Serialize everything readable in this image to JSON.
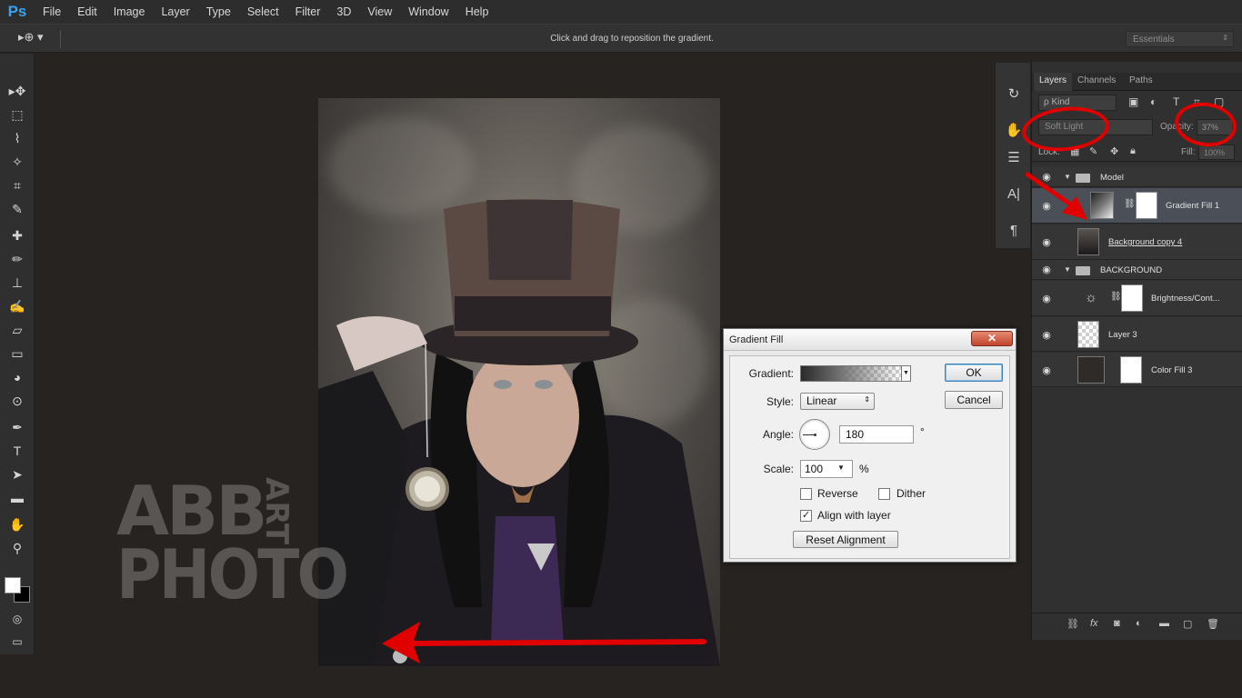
{
  "app": {
    "logo": "Ps"
  },
  "menu": [
    "File",
    "Edit",
    "Image",
    "Layer",
    "Type",
    "Select",
    "Filter",
    "3D",
    "View",
    "Window",
    "Help"
  ],
  "options_bar": {
    "tool_preset": "▸⊕ ▾",
    "hint": "Click and drag to reposition the gradient.",
    "workspace": "Essentials"
  },
  "tools": {
    "icons": [
      "move-tool-icon",
      "marquee-tool-icon",
      "lasso-tool-icon",
      "magic-wand-tool-icon",
      "crop-tool-icon",
      "eyedropper-tool-icon",
      "healing-brush-tool-icon",
      "brush-tool-icon",
      "clone-stamp-tool-icon",
      "history-brush-tool-icon",
      "eraser-tool-icon",
      "gradient-tool-icon",
      "blur-tool-icon",
      "dodge-tool-icon",
      "pen-tool-icon",
      "type-tool-icon",
      "path-selection-tool-icon",
      "rectangle-tool-icon",
      "hand-tool-icon",
      "zoom-tool-icon"
    ],
    "glyphs": [
      "▸✥",
      "⬚",
      "⌇",
      "✧",
      "⌗",
      "✎",
      "✚",
      "✏",
      "⊥",
      "✍",
      "▱",
      "▭",
      "◕",
      "⊙",
      "✒",
      "T",
      "➤",
      "▬",
      "✋",
      "⚲"
    ],
    "foreground_color": "#ffffff",
    "background_color": "#000000"
  },
  "canvas": {
    "watermark": {
      "line1": "ABB",
      "line2": "PHOTO",
      "vertical": "ART"
    }
  },
  "layers_panel": {
    "tabs": [
      "Layers",
      "Channels",
      "Paths"
    ],
    "active_tab": "Layers",
    "kind_filter": "ρ Kind",
    "blend_mode": "Soft Light",
    "opacity_label": "Opacity:",
    "opacity": "37%",
    "lock_label": "Lock:",
    "fill_label": "Fill:",
    "fill": "100%",
    "layers": [
      {
        "name": "Model",
        "type": "group"
      },
      {
        "name": "Gradient Fill 1",
        "type": "gradient-fill",
        "selected": true
      },
      {
        "name": "Background copy 4",
        "type": "pixel"
      },
      {
        "name": "BACKGROUND",
        "type": "group"
      },
      {
        "name": "Brightness/Cont...",
        "type": "adjustment"
      },
      {
        "name": "Layer 3",
        "type": "pixel"
      },
      {
        "name": "Color Fill 3",
        "type": "color-fill"
      }
    ]
  },
  "dialog": {
    "title": "Gradient Fill",
    "close": "✕",
    "gradient_label": "Gradient:",
    "style_label": "Style:",
    "style_value": "Linear",
    "angle_label": "Angle:",
    "angle_value": "180",
    "angle_unit": "°",
    "scale_label": "Scale:",
    "scale_value": "100",
    "scale_unit": "%",
    "reverse_label": "Reverse",
    "reverse_checked": false,
    "dither_label": "Dither",
    "dither_checked": false,
    "align_label": "Align with layer",
    "align_checked": true,
    "reset_label": "Reset Alignment",
    "ok_label": "OK",
    "cancel_label": "Cancel"
  },
  "annotation_color": "#e00000"
}
